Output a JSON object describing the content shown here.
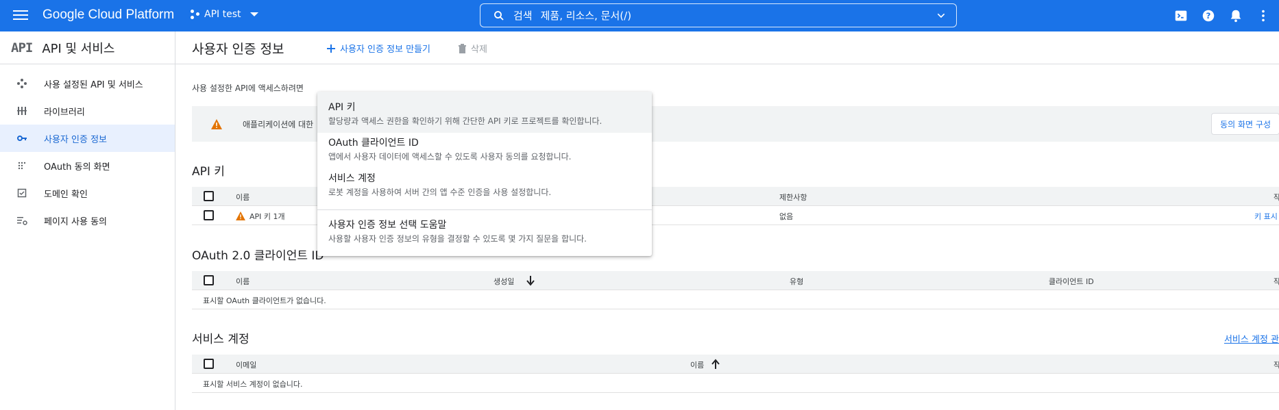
{
  "topbar": {
    "brand": "Google Cloud Platform",
    "project": "API test",
    "search_label": "검색",
    "search_placeholder": "제품, 리소스, 문서(/)"
  },
  "sidenav": {
    "logo_text": "API",
    "title": "API 및 서비스",
    "items": [
      {
        "label": "사용 설정된 API 및 서비스",
        "icon": "api-diamond-icon"
      },
      {
        "label": "라이브러리",
        "icon": "library-icon"
      },
      {
        "label": "사용자 인증 정보",
        "icon": "key-icon",
        "active": true
      },
      {
        "label": "OAuth 동의 화면",
        "icon": "dots-grid-icon"
      },
      {
        "label": "도메인 확인",
        "icon": "checkbox-icon"
      },
      {
        "label": "페이지 사용 동의",
        "icon": "settings-list-icon"
      }
    ]
  },
  "page": {
    "title": "사용자 인증 정보",
    "create_label": "사용자 인증 정보 만들기",
    "delete_label": "삭제",
    "intro": "사용 설정한 API에 액세스하려면",
    "banner_text": "애플리케이션에 대한",
    "consent_button": "동의 화면 구성"
  },
  "api_keys": {
    "title": "API 키",
    "columns": {
      "name": "이름",
      "restrictions": "제한사항",
      "action": "작"
    },
    "rows": [
      {
        "name": "API 키 1개",
        "restrictions": "없음",
        "action": "키 표시"
      }
    ]
  },
  "oauth": {
    "title": "OAuth 2.0 클라이언트 ID",
    "columns": {
      "name": "이름",
      "created": "생성일",
      "type": "유형",
      "client_id": "클라이언트 ID",
      "action": "작"
    },
    "empty": "표시할 OAuth 클라이언트가 없습니다."
  },
  "service_accounts": {
    "title": "서비스 계정",
    "manage_link": "서비스 계정 관",
    "columns": {
      "email": "이메일",
      "name": "이름",
      "action": "작"
    },
    "empty": "표시할 서비스 계정이 없습니다."
  },
  "menu": {
    "items": [
      {
        "title": "API 키",
        "desc": "할당량과 액세스 권한을 확인하기 위해 간단한 API 키로 프로젝트를 확인합니다."
      },
      {
        "title": "OAuth 클라이언트 ID",
        "desc": "앱에서 사용자 데이터에 액세스할 수 있도록 사용자 동의를 요청합니다."
      },
      {
        "title": "서비스 계정",
        "desc": "로봇 계정을 사용하여 서버 간의 앱 수준 인증을 사용 설정합니다."
      },
      {
        "title": "사용자 인증 정보 선택 도움말",
        "desc": "사용할 사용자 인증 정보의 유형을 결정할 수 있도록 몇 가지 질문을 합니다."
      }
    ]
  },
  "colors": {
    "primary": "#1a73e8",
    "active_bg": "#e8f0fe",
    "warning": "#e37400"
  }
}
